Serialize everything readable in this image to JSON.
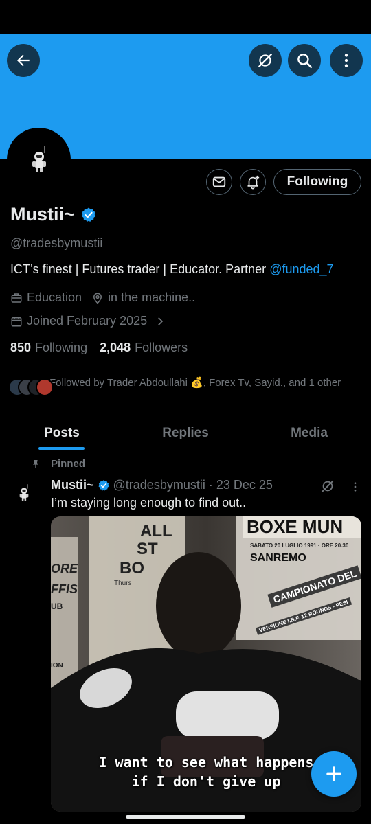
{
  "profile": {
    "name": "Mustii~",
    "handle": "@tradesbymustii",
    "bio_text": "ICT’s finest | Futures trader | Educator. Partner ",
    "bio_link": "@funded_7",
    "category": "Education",
    "location": "in the machine..",
    "joined": "Joined February 2025",
    "following_count": "850",
    "following_label": "Following",
    "followers_count": "2,048",
    "followers_label": "Followers",
    "followed_by": "Followed by Trader Abdoullahi 💰, Forex Tv, Sayid., and 1 other",
    "follow_button": "Following",
    "verified": true
  },
  "header": {
    "banner_color": "#1d9bf0",
    "icons": [
      "back-arrow-icon",
      "grok-icon",
      "search-icon",
      "more-vertical-icon"
    ]
  },
  "actions": {
    "icons": [
      "message-icon",
      "notification-bell-icon"
    ]
  },
  "tabs": [
    {
      "label": "Posts",
      "active": true
    },
    {
      "label": "Replies",
      "active": false
    },
    {
      "label": "Media",
      "active": false
    }
  ],
  "post": {
    "pinned_label": "Pinned",
    "author": "Mustii~",
    "handle_date": "@tradesbymustii · 23 Dec 25",
    "text": "I’m staying long enough to find out..",
    "caption_line1": "I want to see what happens",
    "caption_line2": "if I don't give up",
    "poster_texts": [
      "ALL",
      "ST",
      "BO",
      "ORE",
      "FFIS",
      "UB",
      "ION",
      "BOXE MUN",
      "SABATO 20 LUGLIO 1991 · ORE 20.30",
      "SANREMO",
      "CAMPIONATO DEL",
      "VERSIONE I.B.F. 12 ROUNDS - PESI",
      "Thurs"
    ]
  },
  "colors": {
    "accent": "#1d9bf0",
    "background": "#000000",
    "text_primary": "#e7e9ea",
    "text_secondary": "#71767b"
  }
}
